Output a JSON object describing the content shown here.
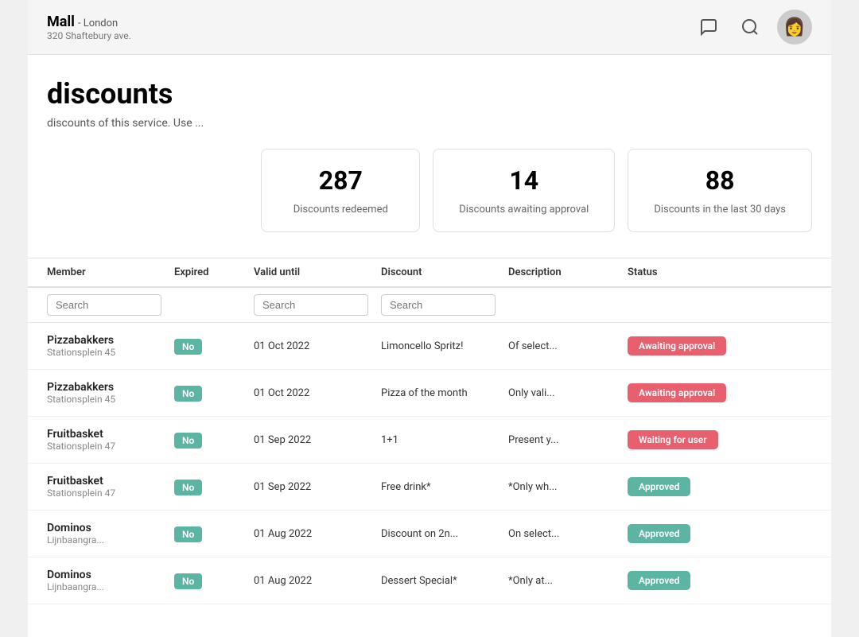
{
  "topbar": {
    "store_name": "Mall",
    "store_subtitle": "- London",
    "store_address": "320 Shaftebury ave.",
    "avatar_label": "👤"
  },
  "page": {
    "title": "discounts",
    "description": "discounts of this service. Use ..."
  },
  "stats": [
    {
      "number": "287",
      "label": "Discounts redeemed"
    },
    {
      "number": "14",
      "label": "Discounts awaiting approval"
    },
    {
      "number": "88",
      "label": "Discounts in the last 30 days"
    }
  ],
  "table": {
    "headers": [
      "Member",
      "Expired",
      "Valid until",
      "Discount",
      "Description",
      "Status"
    ],
    "search_placeholders": [
      "Search",
      "Search",
      "Search"
    ],
    "rows": [
      {
        "member_name": "Pizzabakkers",
        "member_address": "Stationsplein 45",
        "expired": "No",
        "valid_until": "01 Oct 2022",
        "discount": "Limoncello Spritz!",
        "description": "Of select...",
        "status": "Awaiting approval",
        "status_type": "awaiting"
      },
      {
        "member_name": "Pizzabakkers",
        "member_address": "Stationsplein 45",
        "expired": "No",
        "valid_until": "01 Oct 2022",
        "discount": "Pizza of the month",
        "description": "Only vali...",
        "status": "Awaiting approval",
        "status_type": "awaiting"
      },
      {
        "member_name": "Fruitbasket",
        "member_address": "Stationsplein 47",
        "expired": "No",
        "valid_until": "01 Sep 2022",
        "discount": "1+1",
        "description": "Present y...",
        "status": "Waiting for user",
        "status_type": "waiting"
      },
      {
        "member_name": "Fruitbasket",
        "member_address": "Stationsplein 47",
        "expired": "No",
        "valid_until": "01 Sep 2022",
        "discount": "Free drink*",
        "description": "*Only wh...",
        "status": "Approved",
        "status_type": "approved"
      },
      {
        "member_name": "Dominos",
        "member_address": "Lijnbaangra...",
        "expired": "No",
        "valid_until": "01 Aug 2022",
        "discount": "Discount on 2n...",
        "description": "On select...",
        "status": "Approved",
        "status_type": "approved"
      },
      {
        "member_name": "Dominos",
        "member_address": "Lijnbaangra...",
        "expired": "No",
        "valid_until": "01 Aug 2022",
        "discount": "Dessert Special*",
        "description": "*Only at...",
        "status": "Approved",
        "status_type": "approved"
      }
    ]
  }
}
